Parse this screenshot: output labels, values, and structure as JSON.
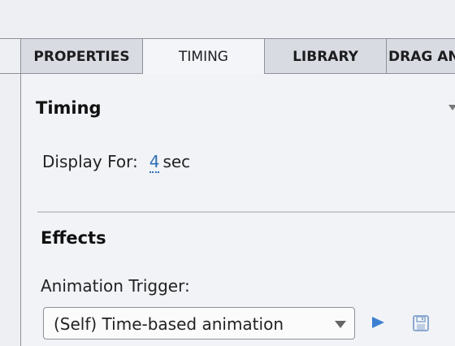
{
  "tabs": {
    "properties": "PROPERTIES",
    "timing": "TIMING",
    "library": "LIBRARY",
    "drag": "DRAG AN"
  },
  "timing": {
    "title": "Timing",
    "display_label": "Display For:",
    "display_value": "4",
    "display_unit": "sec"
  },
  "effects": {
    "title": "Effects",
    "trigger_label": "Animation Trigger:",
    "trigger_selected": "(Self) Time-based animation"
  },
  "icons": {
    "collapse": "chevron-down-icon",
    "play": "play-icon",
    "save": "save-icon"
  },
  "colors": {
    "accent": "#3d7fd0",
    "link": "#2c6fb5"
  }
}
